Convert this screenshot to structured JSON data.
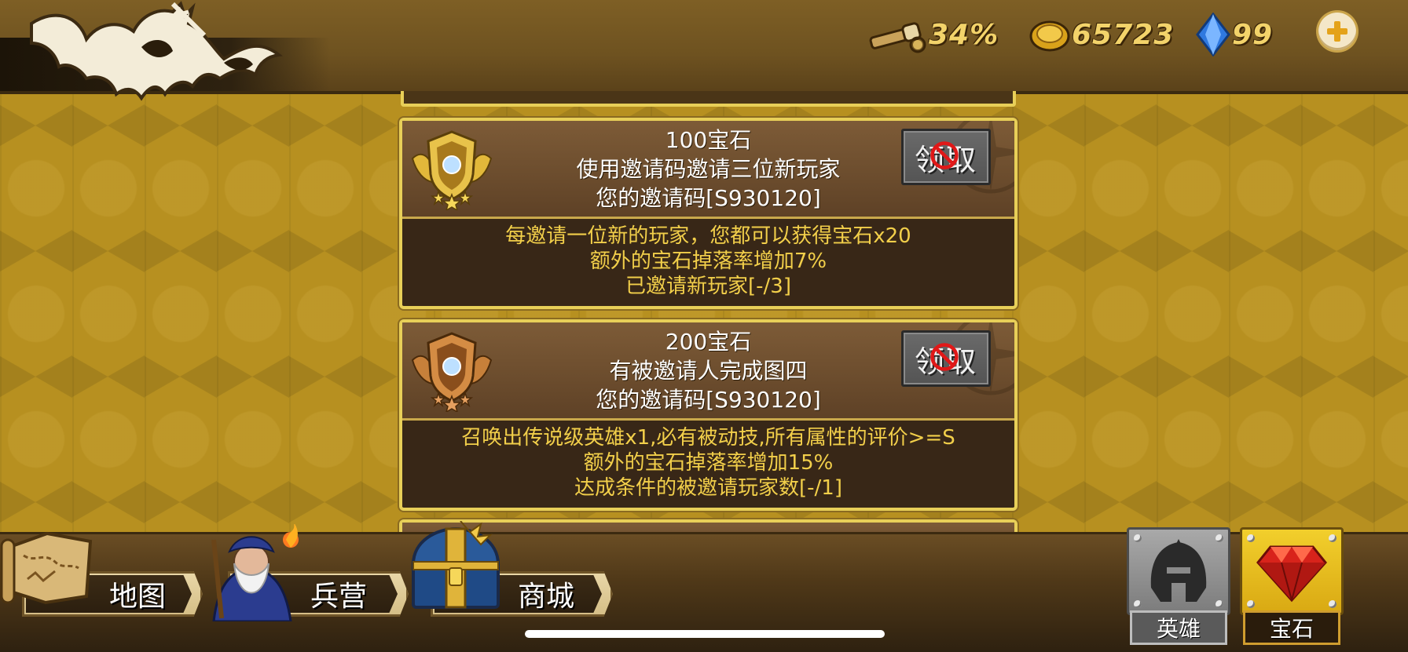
{
  "resources": {
    "explore_percent": "34%",
    "gold": "65723",
    "gems": "99"
  },
  "rewards": [
    {
      "title": "100宝石",
      "description": "使用邀请码邀请三位新玩家",
      "code_line": "您的邀请码[S930120]",
      "claim_label": "领取",
      "claim_state": "disabled",
      "details": [
        "每邀请一位新的玩家，您都可以获得宝石x20",
        "额外的宝石掉落率增加7%",
        "已邀请新玩家[-/3]"
      ]
    },
    {
      "title": "200宝石",
      "description": "有被邀请人完成图四",
      "code_line": "您的邀请码[S930120]",
      "claim_label": "领取",
      "claim_state": "disabled",
      "details": [
        "召唤出传说级英雄x1,必有被动技,所有属性的评价>=S",
        "额外的宝石掉落率增加15%",
        "达成条件的被邀请玩家数[-/1]"
      ]
    }
  ],
  "bottom_nav": {
    "map": "地图",
    "barracks": "兵营",
    "shop": "商城"
  },
  "side_tabs": {
    "hero": "英雄",
    "gem": "宝石",
    "active": "gem"
  },
  "colors": {
    "card_border": "#e8cf58",
    "detail_text": "#f2cf4a",
    "gold_text": "#f3d36a",
    "background": "#b79020"
  }
}
